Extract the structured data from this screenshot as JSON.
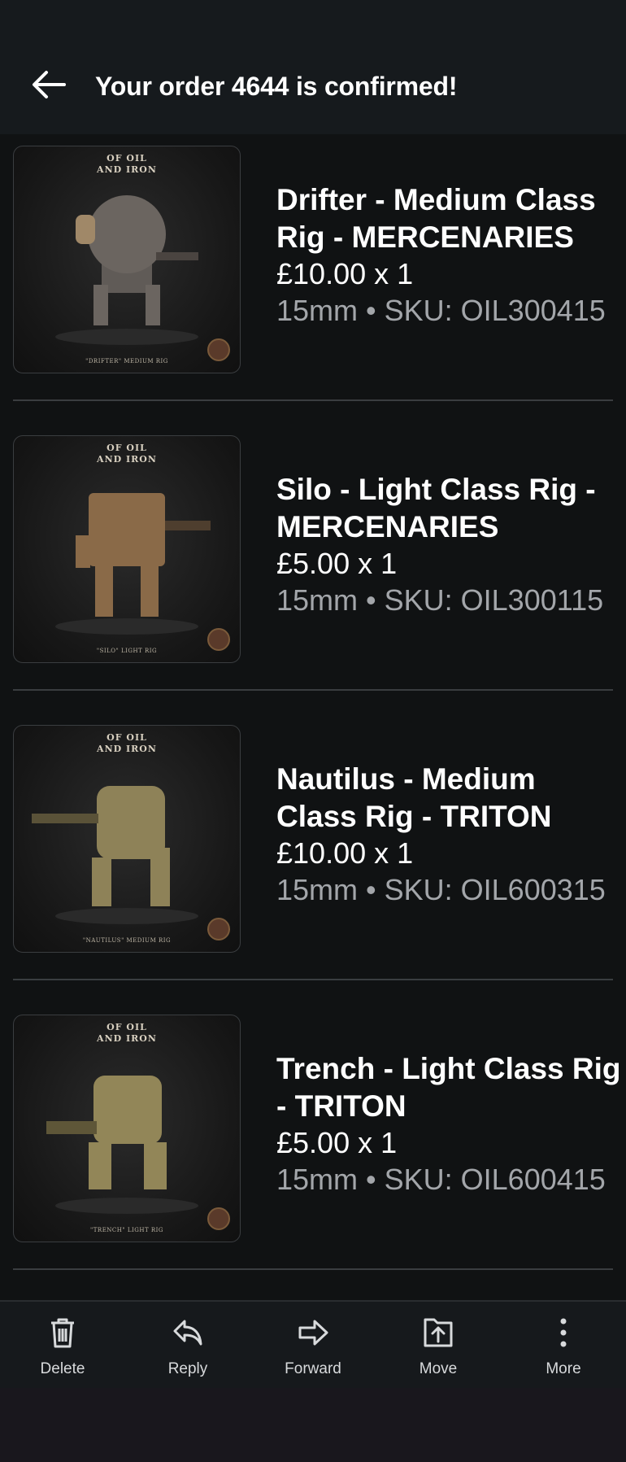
{
  "header": {
    "title": "Your order 4644 is confirmed!"
  },
  "items": [
    {
      "name_line1": "Drifter - Medium Class",
      "name_line2": "Rig - MERCENARIES",
      "price": "£10.00 x 1",
      "meta": "15mm • SKU: OIL300415",
      "thumb": {
        "brand": "OF OIL\nAND IRON",
        "caption": "\"DRIFTER\"  MEDIUM RIG",
        "body_color": "#6b6560"
      }
    },
    {
      "name_line1": "Silo - Light Class Rig -",
      "name_line2": "MERCENARIES",
      "price": "£5.00 x 1",
      "meta": "15mm • SKU: OIL300115",
      "thumb": {
        "brand": "OF OIL\nAND IRON",
        "caption": "\"SILO\"  LIGHT RIG",
        "body_color": "#8a6a48"
      }
    },
    {
      "name_line1": "Nautilus - Medium",
      "name_line2": "Class Rig - TRITON",
      "price": "£10.00 x 1",
      "meta": "15mm • SKU: OIL600315",
      "thumb": {
        "brand": "OF OIL\nAND IRON",
        "caption": "\"NAUTILUS\"  MEDIUM RIG",
        "body_color": "#8e8258"
      }
    },
    {
      "name_line1": "Trench - Light Class Rig",
      "name_line2": "- TRITON",
      "price": "£5.00 x 1",
      "meta": "15mm • SKU: OIL600415",
      "thumb": {
        "brand": "OF OIL\nAND IRON",
        "caption": "\"TRENCH\"  LIGHT RIG",
        "body_color": "#928658"
      }
    }
  ],
  "toolbar": {
    "delete": "Delete",
    "reply": "Reply",
    "forward": "Forward",
    "move": "Move",
    "more": "More"
  },
  "icons": [
    "back-arrow-icon",
    "trash-icon",
    "reply-icon",
    "forward-icon",
    "move-icon",
    "more-vertical-icon"
  ]
}
